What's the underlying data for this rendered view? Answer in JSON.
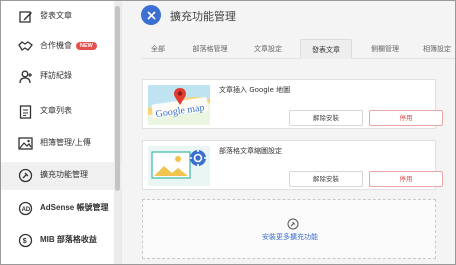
{
  "sidebar": {
    "items": [
      {
        "label": "發表文章",
        "icon": "edit-icon"
      },
      {
        "label": "合作機會",
        "icon": "handshake-icon",
        "badge": "NEW"
      },
      {
        "label": "拜訪紀錄",
        "icon": "user-plus-icon"
      },
      {
        "label": "文章列表",
        "icon": "list-icon"
      },
      {
        "label": "相簿管理/上傳",
        "icon": "image-icon"
      },
      {
        "label": "擴充功能管理",
        "icon": "plugin-icon"
      },
      {
        "label": "AdSense 帳號管理",
        "icon": "adsense-icon"
      },
      {
        "label": "MIB 部落格收益",
        "icon": "mib-icon"
      }
    ],
    "active_index": 5
  },
  "header": {
    "title": "擴充功能管理",
    "close_icon": "close-icon",
    "accent_color": "#3b6fd1"
  },
  "tabs": [
    {
      "label": "全部"
    },
    {
      "label": "部落格管理"
    },
    {
      "label": "文章設定"
    },
    {
      "label": "發表文章"
    },
    {
      "label": "側欄管理"
    },
    {
      "label": "相簿設定"
    }
  ],
  "active_tab": 3,
  "plugins": [
    {
      "title": "文章插入 Google 地圖",
      "uninstall_label": "解除安裝",
      "disable_label": "停用",
      "thumb_text": "Google map"
    },
    {
      "title": "部落格文章縮圖設定",
      "uninstall_label": "解除安裝",
      "disable_label": "停用"
    }
  ],
  "install_more": {
    "label": "安裝更多擴充功能"
  },
  "colors": {
    "danger": "#e0524f",
    "accent": "#3b6fd1"
  }
}
